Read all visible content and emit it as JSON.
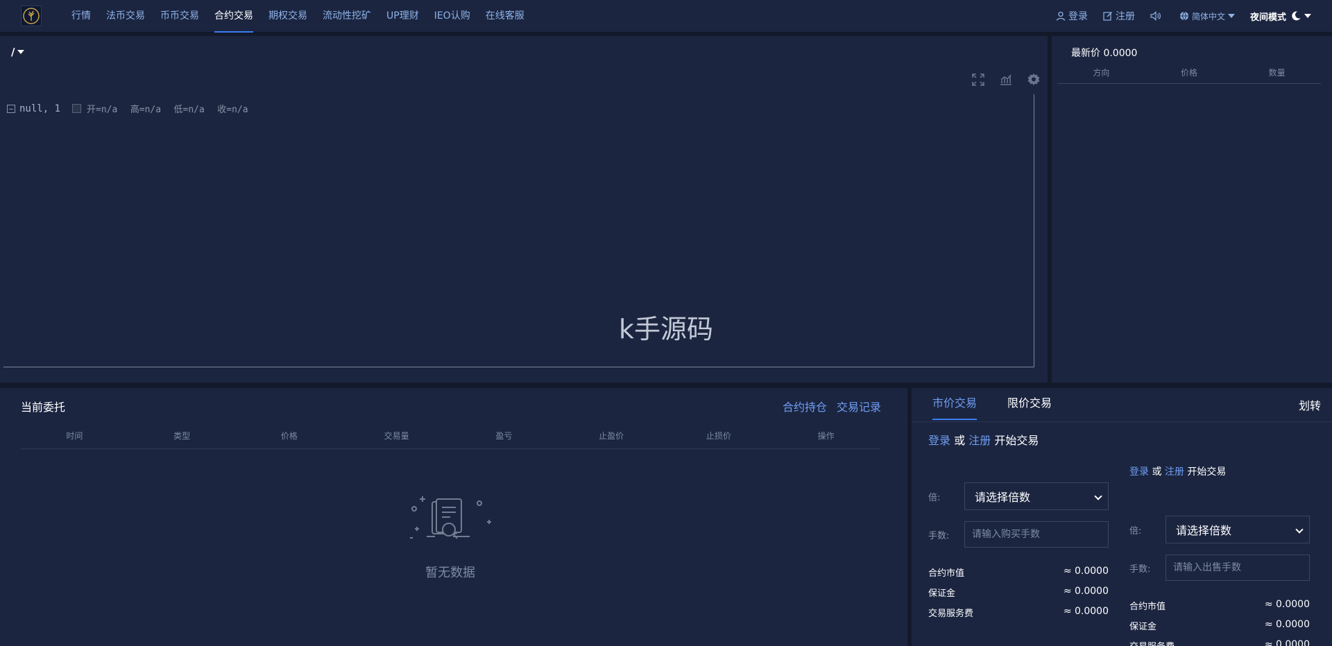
{
  "nav": {
    "items": [
      "行情",
      "法币交易",
      "币币交易",
      "合约交易",
      "期权交易",
      "流动性挖矿",
      "UP理财",
      "IEO认购",
      "在线客服"
    ],
    "active_index": 3,
    "login": "登录",
    "register": "注册",
    "language": "简体中文",
    "night_mode": "夜间模式"
  },
  "chart": {
    "pair": "/",
    "legend_series": "null, 1",
    "ohlc_open": "开=n/a",
    "ohlc_high": "高=n/a",
    "ohlc_low": "低=n/a",
    "ohlc_close": "收=n/a",
    "watermark": "k手源码"
  },
  "book": {
    "latest_price": "最新价 0.0000",
    "headers": [
      "方向",
      "价格",
      "数量"
    ]
  },
  "orders": {
    "title": "当前委托",
    "links": [
      "合约持仓",
      "交易记录"
    ],
    "headers": [
      "时间",
      "类型",
      "价格",
      "交易量",
      "盈亏",
      "止盈价",
      "止损价",
      "操作"
    ],
    "empty_text": "暂无数据"
  },
  "trade": {
    "tabs": [
      "市价交易",
      "限价交易"
    ],
    "transfer": "划转",
    "login": "登录",
    "or": "或",
    "register": "注册",
    "start": "开始交易",
    "leverage_label": "倍:",
    "leverage_placeholder": "请选择倍数",
    "lots_label": "手数:",
    "buy_placeholder": "请输入购买手数",
    "sell_placeholder": "请输入出售手数",
    "contract_value_label": "合约市值",
    "margin_label": "保证金",
    "fee_label": "交易服务费",
    "value": "≈ 0.0000"
  }
}
